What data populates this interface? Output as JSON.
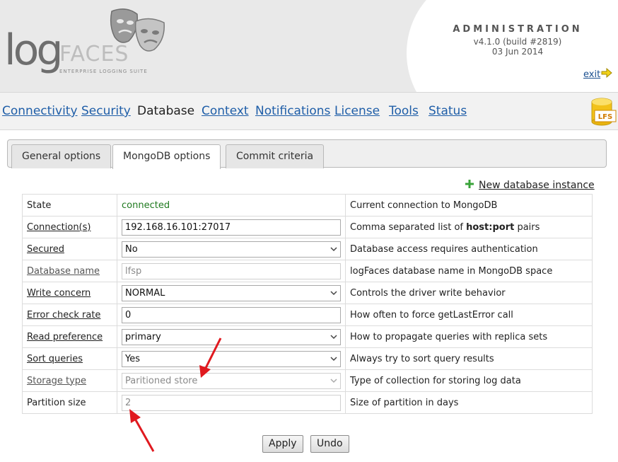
{
  "header": {
    "logo_log": "log",
    "logo_faces": "FACES",
    "logo_suite": "ENTERPRISE LOGGING SUITE",
    "admin_title": "ADMINISTRATION",
    "version": "v4.1.0 (build #2819)",
    "date": "03 Jun 2014",
    "exit_label": "exit"
  },
  "nav": {
    "items": [
      "Connectivity",
      "Security",
      "Database",
      "Context",
      "Notifications",
      "License",
      "Tools",
      "Status"
    ],
    "active": "Database",
    "badge": "LFS"
  },
  "tabs": [
    "General options",
    "MongoDB options",
    "Commit criteria"
  ],
  "new_instance_label": "New database instance",
  "rows": [
    {
      "label": "State",
      "value": "connected",
      "desc": "Current connection to MongoDB"
    },
    {
      "label": "Connection(s)",
      "value": "192.168.16.101:27017",
      "desc_pre": "Comma separated list of ",
      "desc_bold": "host:port",
      "desc_post": " pairs"
    },
    {
      "label": "Secured",
      "value": "No",
      "desc": "Database access requires authentication"
    },
    {
      "label": "Database name",
      "value": "lfsp",
      "desc": "logFaces database name in MongoDB space"
    },
    {
      "label": "Write concern",
      "value": "NORMAL",
      "desc": "Controls the driver write behavior"
    },
    {
      "label": "Error check rate",
      "value": "0",
      "desc": "How often to force getLastError call"
    },
    {
      "label": "Read preference",
      "value": "primary",
      "desc": "How to propagate queries with replica sets"
    },
    {
      "label": "Sort queries",
      "value": "Yes",
      "desc": "Always try to sort query results"
    },
    {
      "label": "Storage type",
      "value": "Paritioned store",
      "desc": "Type of collection for storing log data"
    },
    {
      "label": "Partition size",
      "value": "2",
      "desc": "Size of partition in days"
    }
  ],
  "buttons": {
    "apply": "Apply",
    "undo": "Undo"
  },
  "colors": {
    "link": "#1f5ea8",
    "connected": "#1f7a1f",
    "arrow": "#e0191f"
  }
}
